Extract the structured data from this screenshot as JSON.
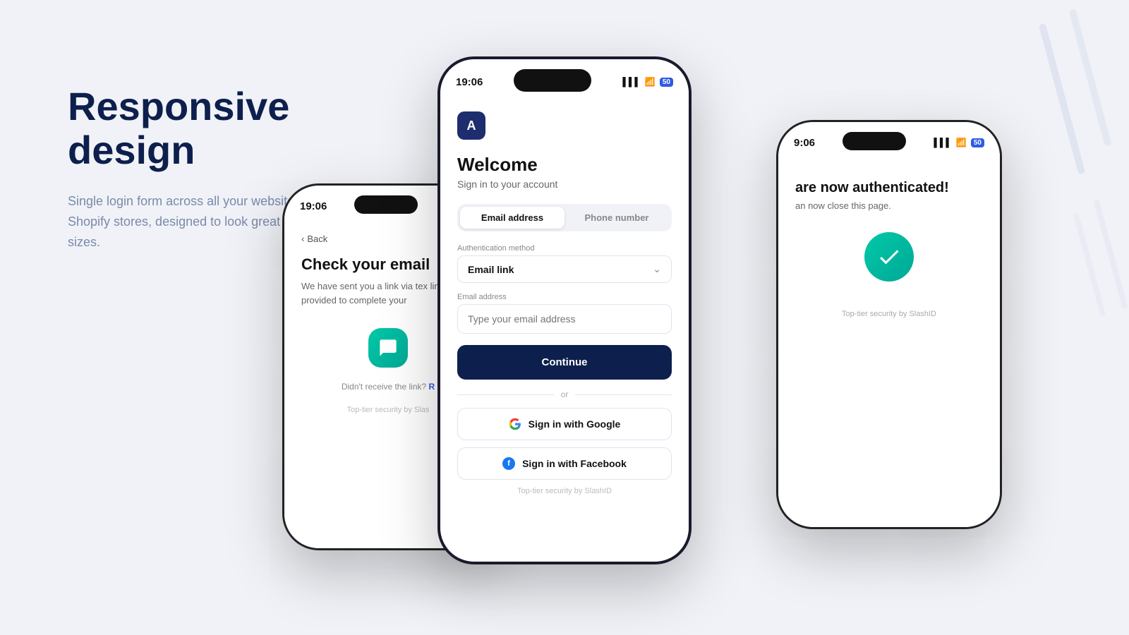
{
  "page": {
    "background_color": "#f0f2f7"
  },
  "left_section": {
    "heading_line1": "Responsive",
    "heading_line2": "design",
    "subtext": "Single login form across all your websites and Shopify stores, designed to look great on all screen sizes."
  },
  "phone_center": {
    "status_time": "19:06",
    "battery": "50",
    "app_icon_letter": "A",
    "welcome_title": "Welcome",
    "welcome_subtitle": "Sign in to your account",
    "tab_email": "Email address",
    "tab_phone": "Phone number",
    "auth_method_label": "Authentication method",
    "auth_method_value": "Email link",
    "email_label": "Email address",
    "email_placeholder": "Type your email address",
    "continue_btn": "Continue",
    "or_text": "or",
    "google_btn": "Sign in with Google",
    "facebook_btn": "Sign in with Facebook",
    "footer": "Top-tier security by SlashID"
  },
  "phone_left": {
    "status_time": "19:06",
    "back_label": "Back",
    "title": "Check your email",
    "description": "We have sent you a link via tex link provided to complete your",
    "resend_text": "Didn't receive the link?",
    "resend_link": "R",
    "footer": "Top-tier security by Slas"
  },
  "phone_right": {
    "status_time": "9:06",
    "battery": "50",
    "title_partial": "are now authenticated!",
    "subtitle_partial": "an now close this page.",
    "footer": "Top-tier security by SlashID"
  },
  "icons": {
    "app_icon": "A",
    "chevron": "⌄",
    "back_arrow": "‹",
    "check": "✓",
    "chat": "💬"
  }
}
